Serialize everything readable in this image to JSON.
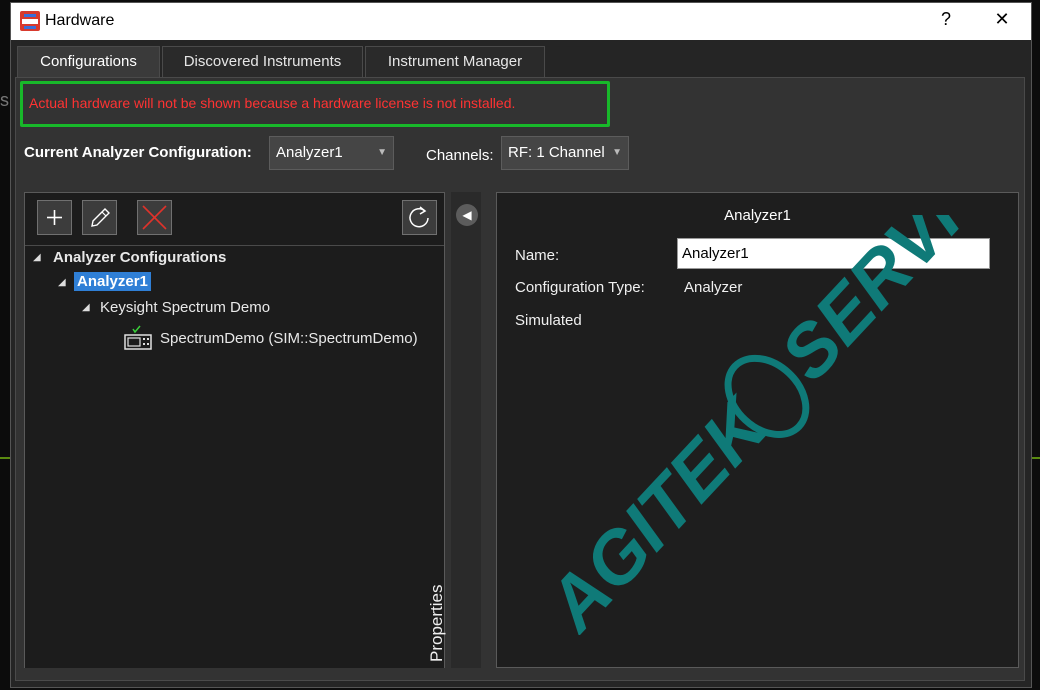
{
  "window": {
    "title": "Hardware",
    "help_label": "?",
    "close_label": "✕"
  },
  "tabs": [
    {
      "label": "Configurations",
      "active": true
    },
    {
      "label": "Discovered Instruments",
      "active": false
    },
    {
      "label": "Instrument Manager",
      "active": false
    }
  ],
  "license_warning": "Actual hardware will not be shown because a hardware license is not installed.",
  "config_bar": {
    "current_label": "Current Analyzer Configuration:",
    "current_value": "Analyzer1",
    "channels_label": "Channels:",
    "channels_value": "RF: 1 Channel"
  },
  "toolbar": {
    "add_icon": "plus-icon",
    "edit_icon": "pencil-icon",
    "delete_icon": "x-icon",
    "refresh_icon": "refresh-icon"
  },
  "tree": {
    "root": "Analyzer Configurations",
    "config": "Analyzer1",
    "group": "Keysight Spectrum Demo",
    "instrument": "SpectrumDemo (SIM::SpectrumDemo)"
  },
  "side_panel_label": "Properties",
  "properties": {
    "title": "Analyzer1",
    "name_label": "Name:",
    "name_value": "Analyzer1",
    "type_label": "Configuration Type:",
    "type_value": "Analyzer",
    "simulated_label": "Simulated"
  },
  "watermark": {
    "text_left": "AGITEK",
    "text_right": "SERVICE",
    "color": "#0f7a78"
  },
  "colors": {
    "warning_text": "#ff3333",
    "highlight_border": "#18b82a",
    "selection": "#2f7fd6"
  }
}
